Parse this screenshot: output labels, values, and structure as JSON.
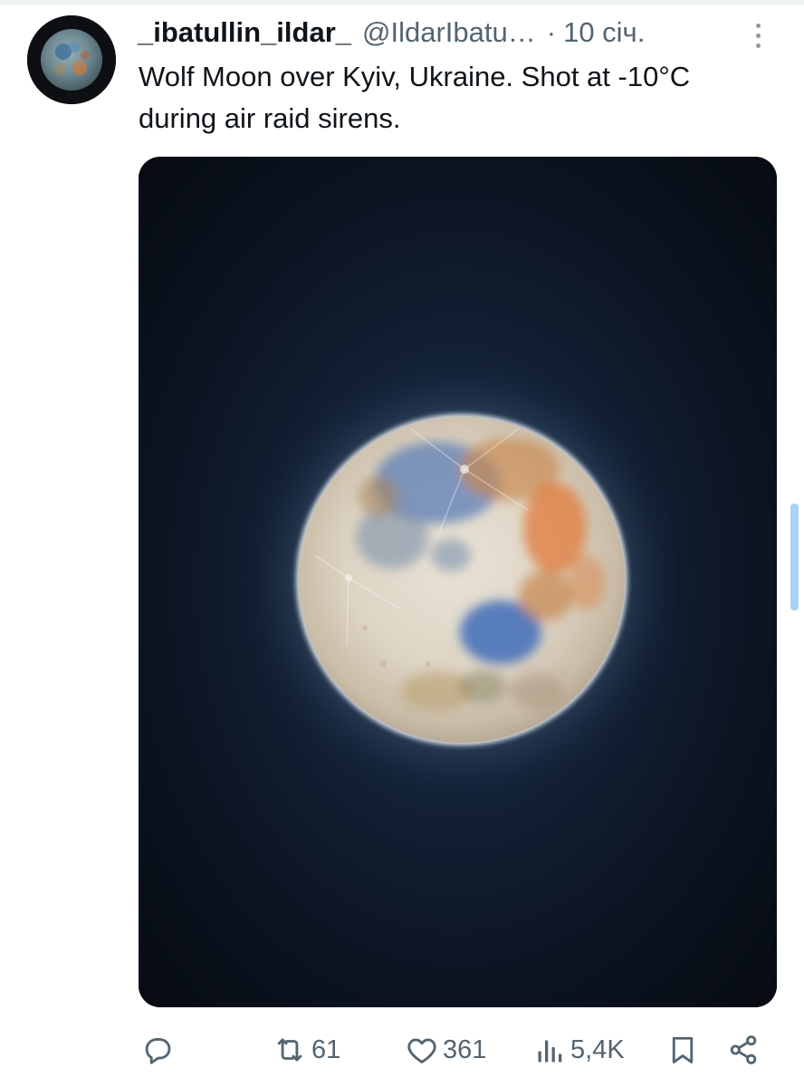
{
  "author": {
    "display_name": "_ibatullin_ildar_",
    "handle": "@IldarIbatu…",
    "separator": "·",
    "date": "10 січ."
  },
  "tweet": {
    "text": "Wolf Moon over Kyiv, Ukraine. Shot at -10°C during air raid sirens."
  },
  "actions": {
    "reply": {
      "icon": "reply-icon",
      "count": ""
    },
    "retweet": {
      "icon": "retweet-icon",
      "count": "61"
    },
    "like": {
      "icon": "heart-icon",
      "count": "361"
    },
    "views": {
      "icon": "views-icon",
      "count": "5,4K"
    },
    "bookmark": {
      "icon": "bookmark-icon"
    },
    "share": {
      "icon": "share-icon"
    }
  },
  "colors": {
    "text_primary": "#0f1419",
    "text_secondary": "#536471",
    "media_background": "#0a1019",
    "scrollbar": "#a7d3f5"
  }
}
